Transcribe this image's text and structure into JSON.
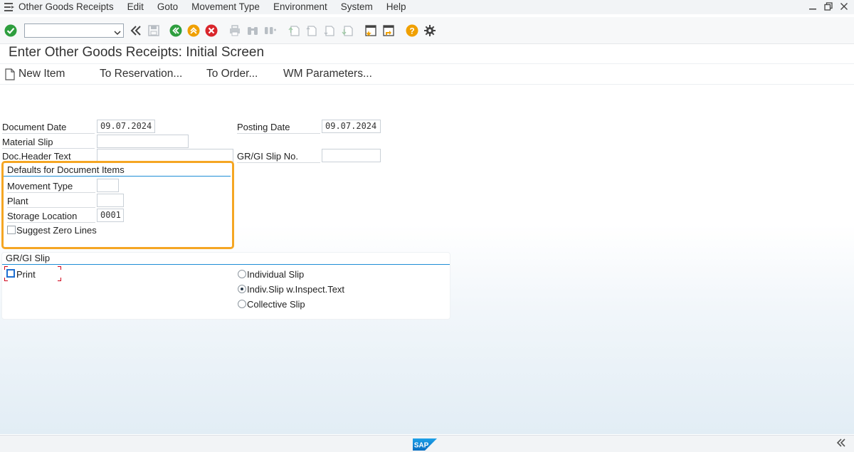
{
  "menu": {
    "items": [
      {
        "label": "Other Goods Receipts"
      },
      {
        "label": "Edit"
      },
      {
        "label": "Goto"
      },
      {
        "label": "Movement Type"
      },
      {
        "label": "Environment"
      },
      {
        "label": "System"
      },
      {
        "label": "Help"
      }
    ]
  },
  "toolbar": {
    "command_value": ""
  },
  "page": {
    "title": "Enter Other Goods Receipts: Initial Screen"
  },
  "appbar": {
    "new_item": "New Item",
    "to_reservation": "To Reservation...",
    "to_order": "To Order...",
    "wm_parameters": "WM Parameters..."
  },
  "form": {
    "document_date_label": "Document Date",
    "document_date_value": "09.07.2024",
    "posting_date_label": "Posting Date",
    "posting_date_value": "09.07.2024",
    "material_slip_label": "Material Slip",
    "material_slip_value": "",
    "doc_header_text_label": "Doc.Header Text",
    "doc_header_text_value": "",
    "grgi_slip_no_label": "GR/GI Slip No.",
    "grgi_slip_no_value": ""
  },
  "defaults": {
    "title": "Defaults for Document Items",
    "movement_type_label": "Movement Type",
    "movement_type_value": "",
    "plant_label": "Plant",
    "plant_value": "",
    "storage_location_label": "Storage Location",
    "storage_location_value": "0001",
    "suggest_zero_lines_label": "Suggest Zero Lines",
    "suggest_zero_lines_checked": false
  },
  "grgi_slip": {
    "title": "GR/GI Slip",
    "print_label": "Print",
    "print_checked": false,
    "options": [
      {
        "label": "Individual Slip",
        "selected": false
      },
      {
        "label": "Indiv.Slip w.Inspect.Text",
        "selected": true
      },
      {
        "label": "Collective Slip",
        "selected": false
      }
    ]
  },
  "colors": {
    "highlight": "#f5a623",
    "group_line": "#1f8ed6",
    "accent_green": "#2e9e3e",
    "accent_orange": "#f0a000",
    "accent_red": "#d9262c"
  },
  "statusbar": {
    "logo": "SAP"
  }
}
